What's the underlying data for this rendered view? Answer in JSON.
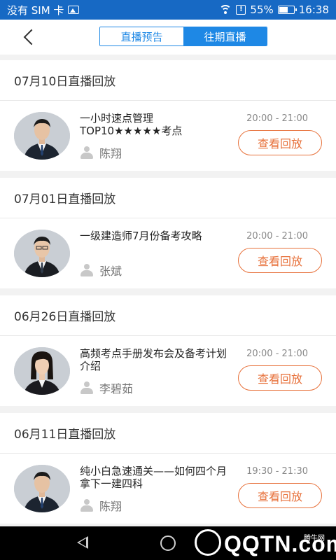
{
  "status_bar": {
    "carrier": "没有 SIM 卡",
    "battery": "55%",
    "time": "16:38"
  },
  "header": {
    "tabs": [
      {
        "label": "直播预告",
        "active": false
      },
      {
        "label": "往期直播",
        "active": true
      }
    ]
  },
  "sections": [
    {
      "date": "07月10日直播回放",
      "title": "一小时速点管理TOP10★★★★★考点",
      "speaker": "陈翔",
      "time": "20:00 - 21:00",
      "button": "查看回放"
    },
    {
      "date": "07月01日直播回放",
      "title": "一级建造师7月份备考攻略",
      "speaker": "张斌",
      "time": "20:00 - 21:00",
      "button": "查看回放"
    },
    {
      "date": "06月26日直播回放",
      "title": "高频考点手册发布会及备考计划介绍",
      "speaker": "李碧茹",
      "time": "20:00 - 21:00",
      "button": "查看回放"
    },
    {
      "date": "06月11日直播回放",
      "title": "纯小白急速通关——如何四个月拿下一建四科",
      "speaker": "陈翔",
      "time": "19:30 - 21:30",
      "button": "查看回放"
    }
  ],
  "watermark": {
    "text": "QQTN.com",
    "sub": "腾牛网"
  },
  "colors": {
    "status_bar": "#1769c4",
    "tab_accent": "#1e88e5",
    "button_accent": "#e7713b"
  }
}
